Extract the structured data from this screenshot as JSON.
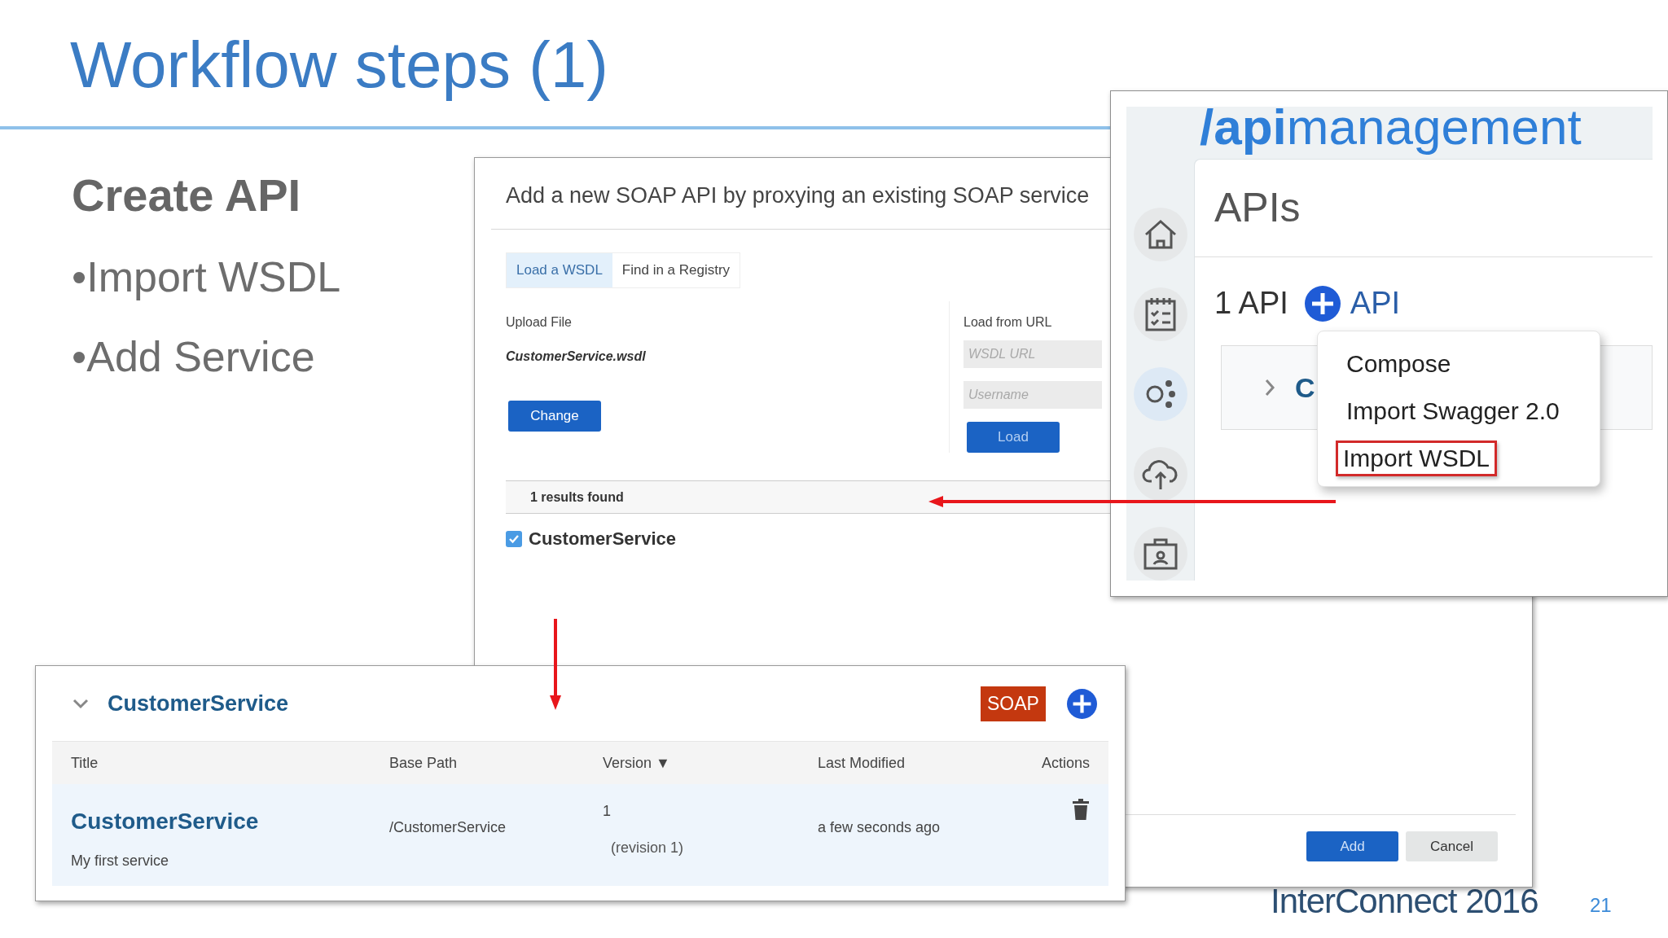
{
  "slide": {
    "title": "Workflow steps (1)",
    "heading": "Create API",
    "bullets": [
      "•Import WSDL",
      "•Add Service"
    ],
    "footer": "InterConnect 2016",
    "page_number": "21"
  },
  "soap_dialog": {
    "title": "Add a new SOAP API by proxying an existing SOAP service",
    "tabs": [
      {
        "label": "Load a WSDL",
        "selected": true
      },
      {
        "label": "Find in a Registry",
        "selected": false
      }
    ],
    "upload_label": "Upload File",
    "file_name": "CustomerService.wsdl",
    "change_button": "Change",
    "url_label": "Load from URL",
    "url_field": {
      "placeholder": "WSDL URL"
    },
    "username_field": {
      "placeholder": "Username"
    },
    "load_button": {
      "label": "Load",
      "disabled": true
    },
    "results": "1 results found",
    "result_item": {
      "label": "CustomerService",
      "checked": true
    },
    "buttons": [
      "Add",
      "Cancel"
    ]
  },
  "api_panel": {
    "logo": "**/api**management",
    "nav": [
      {
        "kind": "home",
        "selected": false
      },
      {
        "kind": "checklist",
        "selected": false
      },
      {
        "kind": "nodes",
        "selected": true
      },
      {
        "kind": "cloud",
        "selected": false
      },
      {
        "kind": "briefcase",
        "selected": false
      }
    ],
    "heading": "APIs",
    "count": "1 API",
    "add_label": "API",
    "row_text": "C",
    "menu": [
      {
        "label": "Compose",
        "highlighted": false
      },
      {
        "label": "Import Swagger 2.0",
        "highlighted": false
      },
      {
        "label": "Import WSDL",
        "highlighted": true
      }
    ]
  },
  "service_card": {
    "name": "CustomerService",
    "expanded": true,
    "badge": "SOAP",
    "columns": [
      "Title",
      "Base Path",
      "Version ▼",
      "Last Modified",
      "Actions"
    ],
    "rows": [
      {
        "title": "CustomerService",
        "description": "My first service",
        "base_path": "/CustomerService",
        "version": "1",
        "revision": "(revision 1)",
        "last_modified": "a few seconds ago"
      }
    ]
  }
}
